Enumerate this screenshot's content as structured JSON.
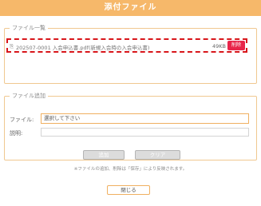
{
  "window": {
    "title": "添付ファイル"
  },
  "file_list": {
    "legend": "ファイル一覧",
    "files": [
      {
        "icon": "paperclip-icon",
        "name": "202507-0001 入会申込書.pdf(新規入会時の入会申込書)",
        "size": "49KB",
        "delete_label": "削除"
      }
    ]
  },
  "file_add": {
    "legend": "ファイル追加",
    "file_label": "ファイル:",
    "file_placeholder": "選択して下さい",
    "desc_label": "説明:",
    "desc_value": "",
    "add_label": "追加",
    "clear_label": "クリア"
  },
  "note": "※ファイルの追加、削除は「保存」により反映されます。",
  "close_label": "閉じる",
  "colors": {
    "title_bar": "#f6b86a",
    "accent_border": "#f0b060",
    "delete": "#e8254a",
    "highlight_dashed": "#d8161b"
  }
}
